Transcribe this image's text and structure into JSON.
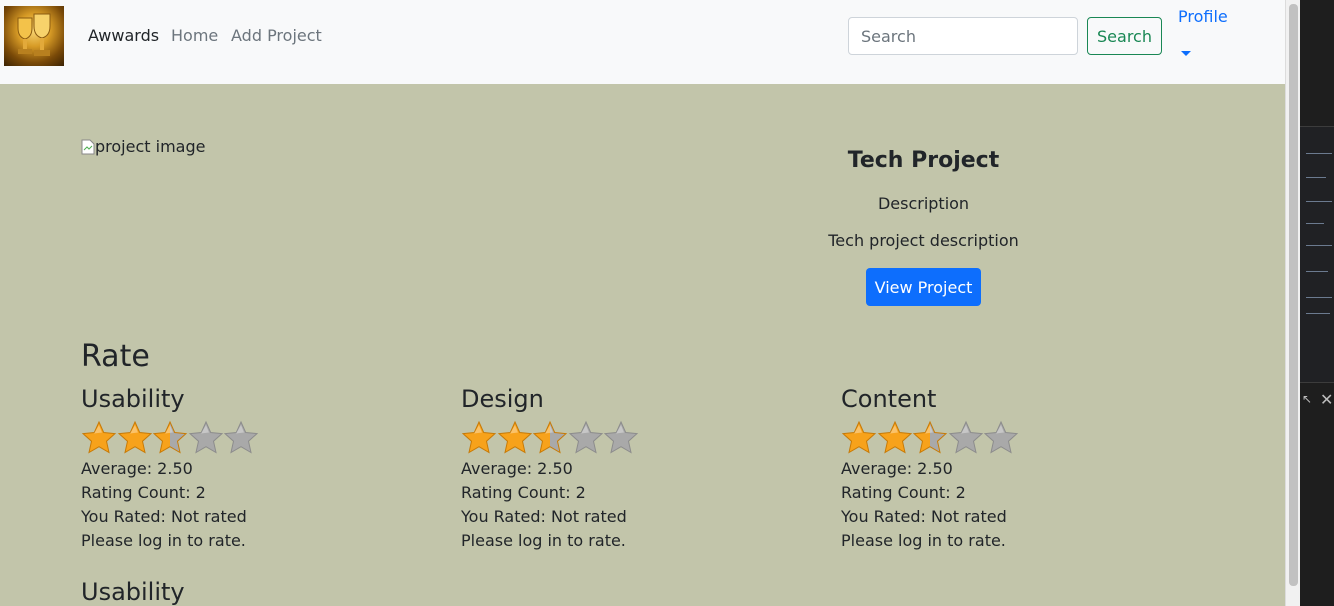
{
  "navbar": {
    "brand": "Awwards",
    "links": [
      "Home",
      "Add Project"
    ],
    "search_placeholder": "Search",
    "search_button": "Search",
    "profile_label": "Profile"
  },
  "project": {
    "image_alt": "project image",
    "title": "Tech Project",
    "description_label": "Description",
    "description": "Tech project description",
    "view_button": "View Project"
  },
  "rate": {
    "heading": "Rate",
    "categories": [
      {
        "name": "Usability",
        "stars_filled": 2.5,
        "stars_total": 5,
        "average": "Average: 2.50",
        "count": "Rating Count: 2",
        "you_rated": "You Rated: Not rated",
        "login_note": "Please log in to rate."
      },
      {
        "name": "Design",
        "stars_filled": 2.5,
        "stars_total": 5,
        "average": "Average: 2.50",
        "count": "Rating Count: 2",
        "you_rated": "You Rated: Not rated",
        "login_note": "Please log in to rate."
      },
      {
        "name": "Content",
        "stars_filled": 2.5,
        "stars_total": 5,
        "average": "Average: 2.50",
        "count": "Rating Count: 2",
        "you_rated": "You Rated: Not rated",
        "login_note": "Please log in to rate."
      }
    ],
    "next_heading": "Usability"
  },
  "colors": {
    "page_bg": "#c2c5aa",
    "navbar_bg": "#f8f9fa",
    "primary": "#0d6efd",
    "success": "#198754",
    "star_gold": "#f7a21b",
    "star_gray": "#a9a9a9"
  },
  "icons": {
    "logo": "trophy-logo-icon",
    "broken_image": "broken-image-icon",
    "caret": "caret-down-icon",
    "star": "star-icon",
    "devtools_close": "close-icon"
  }
}
